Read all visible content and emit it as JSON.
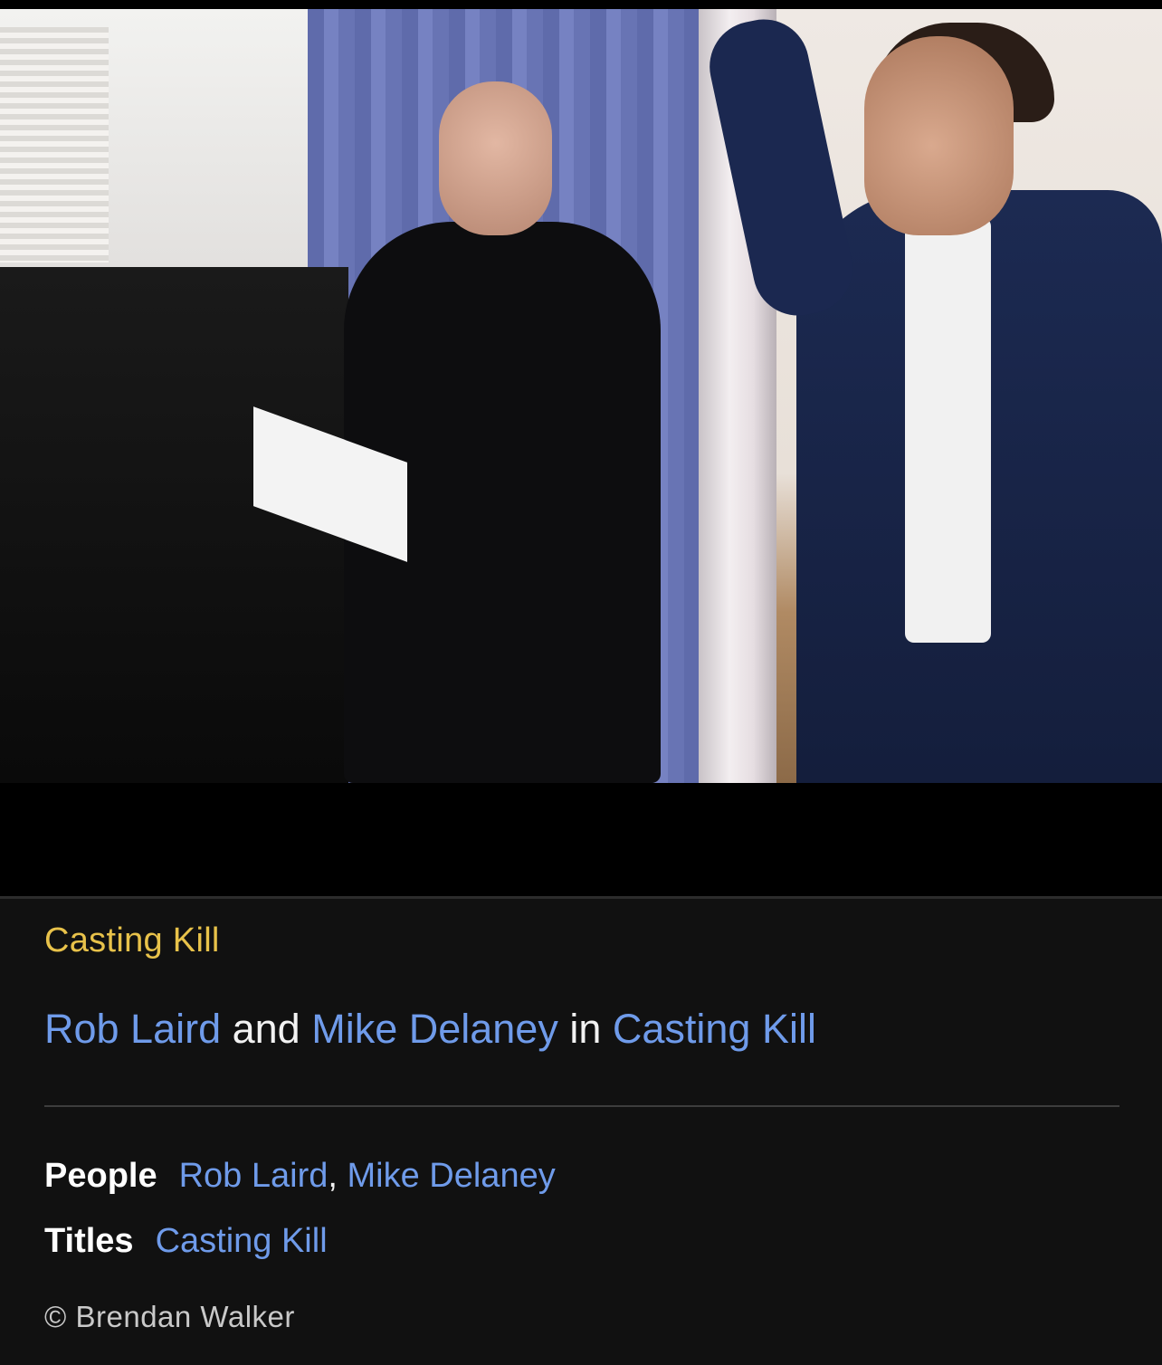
{
  "caption": {
    "title": "Casting Kill",
    "description": {
      "person1": "Rob Laird",
      "connector1": " and ",
      "person2": "Mike Delaney",
      "connector2": " in ",
      "title_link": "Casting Kill"
    },
    "people": {
      "label": "People",
      "items": [
        "Rob Laird",
        "Mike Delaney"
      ],
      "separator": ", "
    },
    "titles": {
      "label": "Titles",
      "items": [
        "Casting Kill"
      ]
    },
    "credit": "© Brendan Walker"
  },
  "colors": {
    "title": "#e8c24a",
    "link": "#6f9bea",
    "background": "#111111"
  }
}
